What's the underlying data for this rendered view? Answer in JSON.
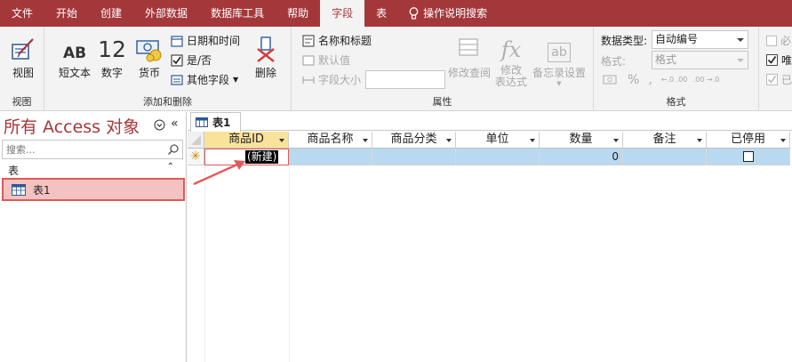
{
  "ribbon_tabs": [
    "文件",
    "开始",
    "创建",
    "外部数据",
    "数据库工具",
    "帮助",
    "字段",
    "表"
  ],
  "active_tab": "字段",
  "tell_me": "操作说明搜索",
  "groups": {
    "view": {
      "button": "视图",
      "label": "视图"
    },
    "add_delete": {
      "label": "添加和删除",
      "short_text": "短文本",
      "short_text_icon": "AB",
      "number": "数字",
      "number_icon": "12",
      "currency": "货币",
      "datetime": "日期和时间",
      "yesno": "是/否",
      "more_fields": "其他字段",
      "delete": "删除"
    },
    "properties": {
      "label": "属性",
      "name_caption": "名称和标题",
      "default_value": "默认值",
      "field_size": "字段大小",
      "modify_lookup": "修改查阅",
      "modify_expression_1": "修改",
      "modify_expression_2": "表达式",
      "memo_settings": "备忘录设置",
      "fx": "fx",
      "ab": "ab"
    },
    "format": {
      "label": "格式",
      "data_type_label": "数据类型:",
      "data_type_value": "自动编号",
      "format_label": "格式:",
      "format_value": "格式",
      "percent": "%",
      "comma": ",",
      "inc_dec_1": "←.0 .00",
      "inc_dec_2": ".00 →.0"
    },
    "validation": {
      "required": "必",
      "unique": "唯",
      "indexed": "已"
    }
  },
  "nav": {
    "title": "所有 Access 对象",
    "search_placeholder": "搜索...",
    "section": "表",
    "items": [
      "表1"
    ]
  },
  "document": {
    "tab": "表1",
    "columns": [
      "商品ID",
      "商品名称",
      "商品分类",
      "单位",
      "数量",
      "备注",
      "已停用"
    ],
    "new_row": {
      "id": "(新建)",
      "quantity": "0",
      "disabled": false
    },
    "new_row_marker": "✳"
  },
  "colors": {
    "accent": "#a4373a",
    "row_highlight": "#b9d9f1",
    "selection": "#f5c2c2",
    "annotation": "#e05a5a"
  }
}
